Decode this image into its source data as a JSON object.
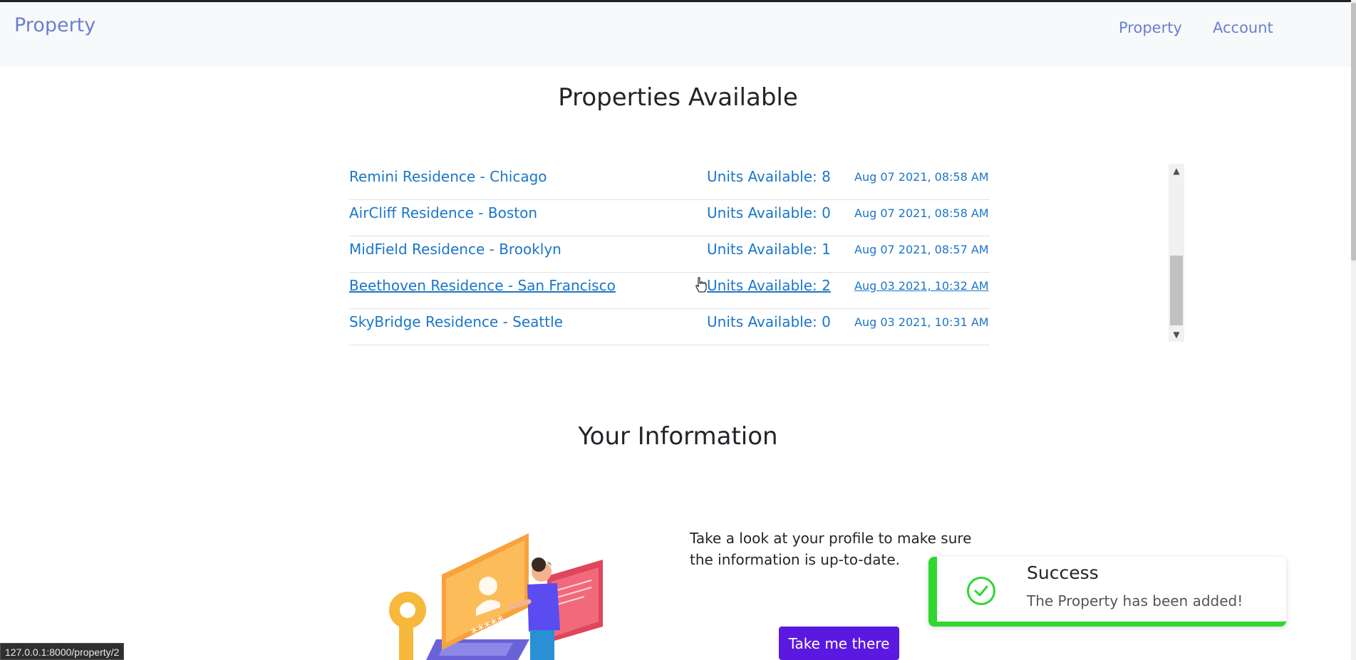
{
  "navbar": {
    "brand": "Property",
    "links": [
      {
        "label": "Property"
      },
      {
        "label": "Account"
      }
    ]
  },
  "properties_section": {
    "title": "Properties Available",
    "items": [
      {
        "name": "Remini Residence - Chicago",
        "units": "Units Available: 8",
        "date": "Aug 07 2021, 08:58 AM"
      },
      {
        "name": "AirCliff Residence - Boston",
        "units": "Units Available: 0",
        "date": "Aug 07 2021, 08:58 AM"
      },
      {
        "name": "MidField Residence - Brooklyn",
        "units": "Units Available: 1",
        "date": "Aug 07 2021, 08:57 AM"
      },
      {
        "name": "Beethoven Residence - San Francisco",
        "units": "Units Available: 2",
        "date": "Aug 03 2021, 10:32 AM"
      },
      {
        "name": "SkyBridge Residence - Seattle",
        "units": "Units Available: 0",
        "date": "Aug 03 2021, 10:31 AM"
      }
    ]
  },
  "info_section": {
    "title": "Your Information",
    "text": "Take a look at your profile to make sure the information is up-to-date.",
    "cta_label": "Take me there",
    "illustration_password": "*****"
  },
  "toast": {
    "title": "Success",
    "message": "The Property has been added!",
    "accent": "#2fd82f"
  },
  "status_bar": {
    "url": "127.0.0.1:8000/property/2"
  },
  "colors": {
    "link": "#1a76c9",
    "nav": "#6a7fd1",
    "button": "#5b18e0"
  }
}
